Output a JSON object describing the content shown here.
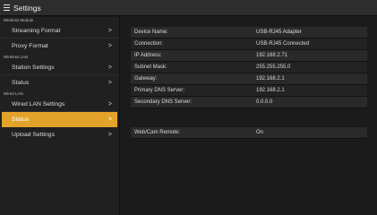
{
  "window": {
    "title": "Settings"
  },
  "sidebar": {
    "sections": [
      {
        "label": "Wireless Module",
        "items": [
          {
            "label": "Streaming Format",
            "active": false
          },
          {
            "label": "Proxy Format",
            "active": false
          }
        ]
      },
      {
        "label": "Wireless LAN",
        "items": [
          {
            "label": "Station Settings",
            "active": false
          },
          {
            "label": "Status",
            "active": false
          }
        ]
      },
      {
        "label": "Wired LAN",
        "items": [
          {
            "label": "Wired LAN Settings",
            "active": false
          },
          {
            "label": "Status",
            "active": true
          },
          {
            "label": "Upload Settings",
            "active": false
          }
        ]
      }
    ],
    "chevron": ">"
  },
  "status": {
    "rows": [
      {
        "key": "Device Name:",
        "value": "USB-RJ45 Adapter"
      },
      {
        "key": "Connection:",
        "value": "USB-RJ45 Connected"
      },
      {
        "key": "IP Address:",
        "value": "192.168.2.71"
      },
      {
        "key": "Subnet Mask:",
        "value": "255.255.255.0"
      },
      {
        "key": "Gateway:",
        "value": "192.168.2.1"
      },
      {
        "key": "Primary DNS Server:",
        "value": "192.168.2.1"
      },
      {
        "key": "Secondary DNS Server:",
        "value": "0.0.0.0"
      }
    ],
    "remote": {
      "key": "Web/Cam Remote:",
      "value": "On"
    }
  },
  "colors": {
    "accent": "#e3a32a",
    "background": "#1a1a1a"
  },
  "icons": {
    "menu": "hamburger-icon",
    "chevron": "chevron-right-icon"
  }
}
